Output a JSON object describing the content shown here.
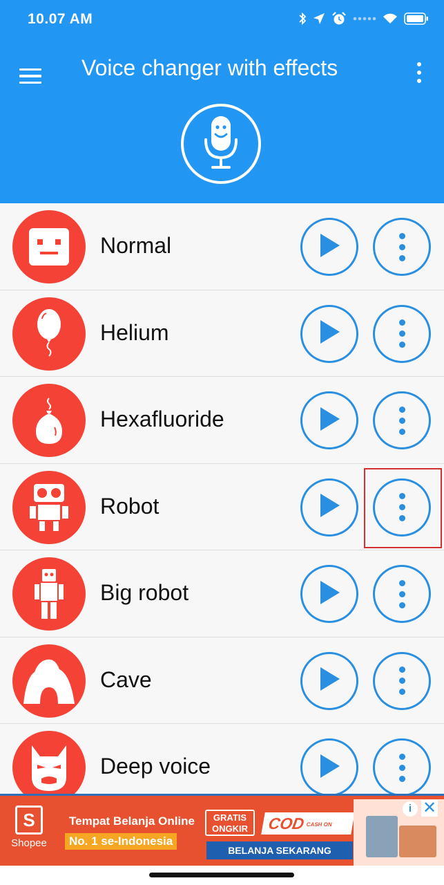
{
  "status_bar": {
    "time": "10.07 AM",
    "icons": [
      "bluetooth-icon",
      "location-arrow-icon",
      "alarm-icon",
      "signal-icon",
      "wifi-icon",
      "battery-icon"
    ]
  },
  "app_bar": {
    "title": "Voice changer with effects",
    "menu_icon": "hamburger-menu-icon",
    "overflow_icon": "more-vert-icon",
    "logo_icon": "smiling-microphone-icon"
  },
  "effects": [
    {
      "label": "Normal",
      "icon": "robot-face-icon"
    },
    {
      "label": "Helium",
      "icon": "balloon-icon"
    },
    {
      "label": "Hexafluoride",
      "icon": "heavy-balloon-icon"
    },
    {
      "label": "Robot",
      "icon": "robot-icon"
    },
    {
      "label": "Big robot",
      "icon": "big-robot-icon"
    },
    {
      "label": "Cave",
      "icon": "cave-icon"
    },
    {
      "label": "Deep voice",
      "icon": "devil-mask-icon"
    }
  ],
  "ad": {
    "brand": "Shopee",
    "brand_letter": "S",
    "headline": "Tempat Belanja Online",
    "subhead": "No. 1 se-Indonesia",
    "badge_line1": "GRATIS",
    "badge_line2": "ONGKIR",
    "cod": "COD",
    "cod_small": "CASH ON DELIVERY",
    "cta": "BELANJA SEKARANG",
    "info": "i",
    "close": "✕"
  },
  "colors": {
    "primary": "#2196f3",
    "accent_red": "#f44336",
    "button_blue": "#2a8fe0",
    "highlight_red": "#d32f2f"
  }
}
